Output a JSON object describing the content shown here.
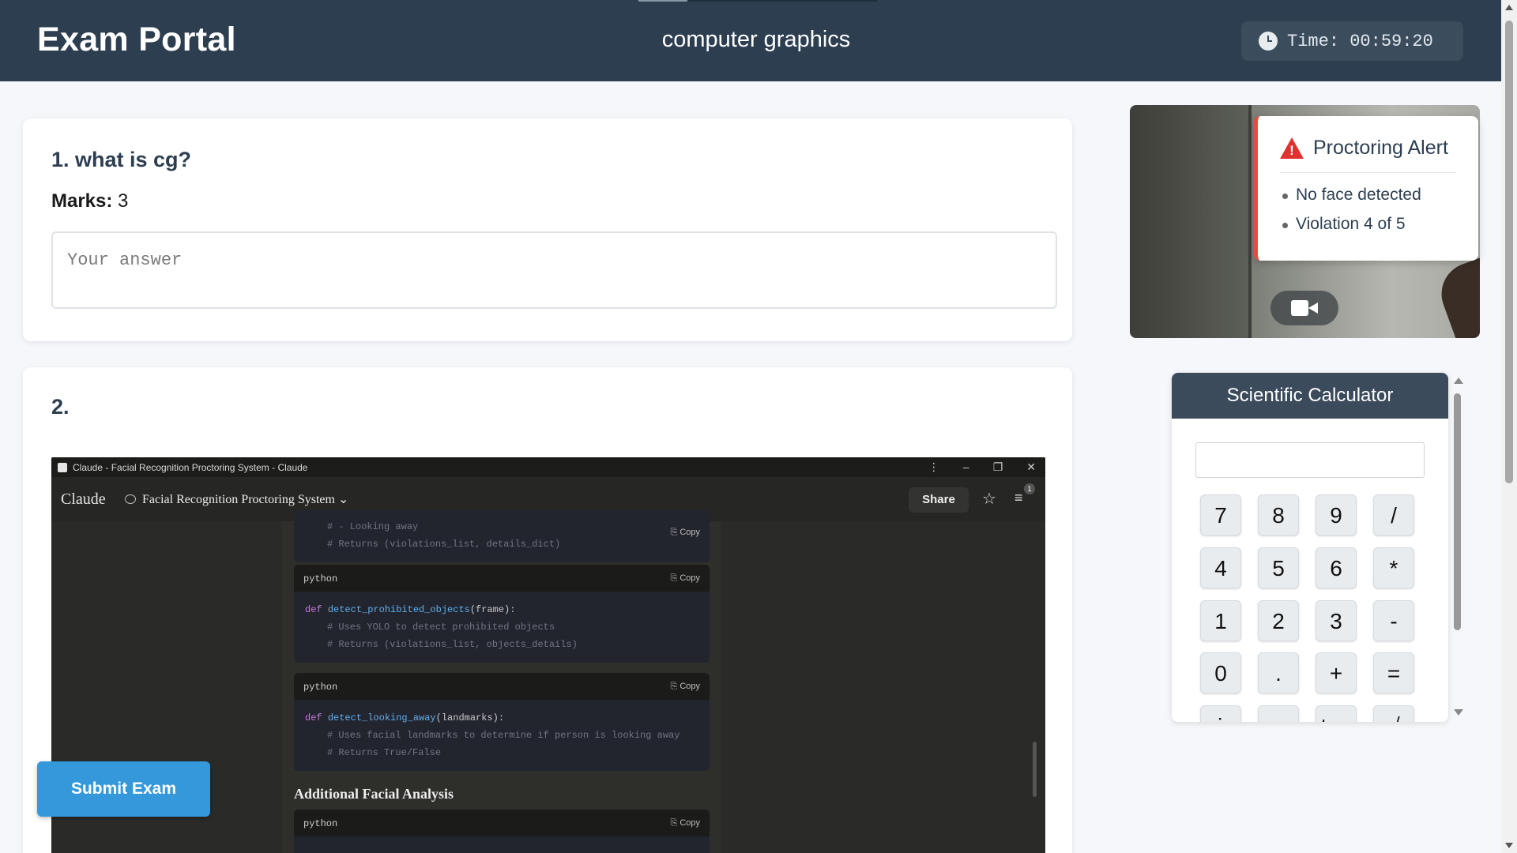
{
  "header": {
    "app_title": "Exam Portal",
    "course_title": "computer graphics",
    "timer_label": "Time: 00:59:20",
    "timer_icon": "clock-icon"
  },
  "questions": [
    {
      "title": "1. what is cg?",
      "marks_label": "Marks:",
      "marks_value": "3",
      "answer_placeholder": "Your answer",
      "answer_value": ""
    },
    {
      "title": "2."
    }
  ],
  "embedded_screenshot": {
    "window_title": "Claude - Facial Recognition Proctoring System - Claude",
    "brand": "Claude",
    "conversation_title": "Facial Recognition Proctoring System ⌄",
    "share_label": "Share",
    "settings_badge": "1",
    "code_blocks": [
      {
        "lang": "",
        "copy_label": "Copy",
        "lines": [
          "# - Looking away",
          "# Returns (violations_list, details_dict)"
        ]
      },
      {
        "lang": "python",
        "copy_label": "Copy",
        "def_kw": "def",
        "fn_name": "detect_prohibited_objects",
        "args": "(frame):",
        "comments": [
          "# Uses YOLO to detect prohibited objects",
          "# Returns (violations_list, objects_details)"
        ]
      },
      {
        "lang": "python",
        "copy_label": "Copy",
        "def_kw": "def",
        "fn_name": "detect_looking_away",
        "args": "(landmarks):",
        "comments": [
          "# Uses facial landmarks to determine if person is looking away",
          "# Returns True/False"
        ]
      },
      {
        "lang": "python",
        "copy_label": "Copy"
      }
    ],
    "section_heading": "Additional Facial Analysis"
  },
  "submit_label": "Submit Exam",
  "proctoring": {
    "alert_title": "Proctoring Alert",
    "items": [
      "No face detected",
      "Violation 4 of 5"
    ],
    "alert_color": "#e03131"
  },
  "calculator": {
    "title": "Scientific Calculator",
    "display_value": "",
    "keys": [
      "7",
      "8",
      "9",
      "/",
      "4",
      "5",
      "6",
      "*",
      "1",
      "2",
      "3",
      "-",
      "0",
      ".",
      "+",
      "=",
      "sin",
      "cos",
      "tan",
      "√"
    ]
  },
  "colors": {
    "header_bg": "#2c3e50",
    "accent": "#3498db",
    "alert": "#e74c3c"
  }
}
